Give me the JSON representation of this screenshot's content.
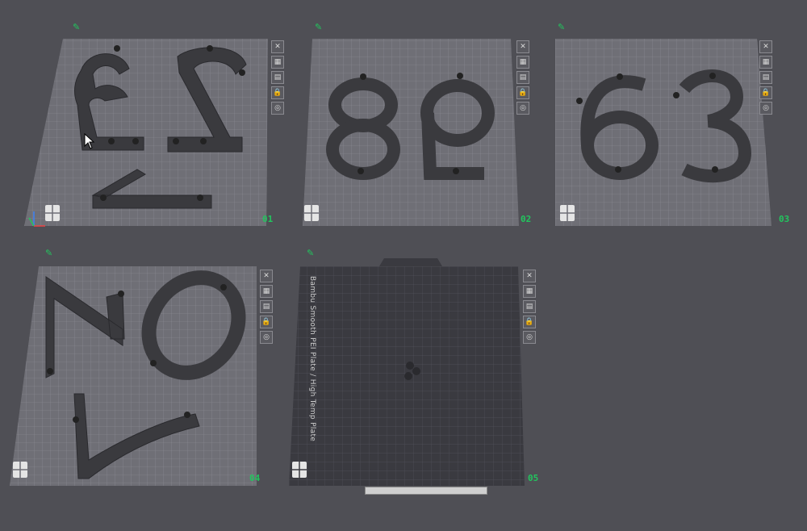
{
  "colors": {
    "background": "#4f4f55",
    "plate_grid": "#9a9aa0",
    "plate_fill": "#6b6b72",
    "plate_dark_fill": "#3a3a40",
    "model": "#3a3a3e",
    "accent": "#22c55e"
  },
  "plates": [
    {
      "number": "01",
      "icons": [
        "edit-icon",
        "close-icon",
        "arrange-icon",
        "auto-orient-icon",
        "lock-icon",
        "settings-icon"
      ]
    },
    {
      "number": "02",
      "icons": [
        "edit-icon",
        "close-icon",
        "arrange-icon",
        "auto-orient-icon",
        "lock-icon",
        "settings-icon"
      ]
    },
    {
      "number": "03",
      "icons": [
        "edit-icon",
        "close-icon",
        "arrange-icon",
        "auto-orient-icon",
        "lock-icon",
        "settings-icon"
      ]
    },
    {
      "number": "04",
      "icons": [
        "edit-icon",
        "close-icon",
        "arrange-icon",
        "auto-orient-icon",
        "lock-icon",
        "settings-icon"
      ]
    },
    {
      "number": "05",
      "icons": [
        "edit-icon",
        "close-icon",
        "arrange-icon",
        "auto-orient-icon",
        "lock-icon",
        "settings-icon"
      ],
      "label": "Bambu Smooth PEI Plate / High Temp Plate"
    }
  ],
  "tool_glyphs": {
    "close": "✕",
    "arrange": "▦",
    "orient": "▤",
    "lock": "🔒",
    "settings": "◎",
    "edit": "✎"
  }
}
